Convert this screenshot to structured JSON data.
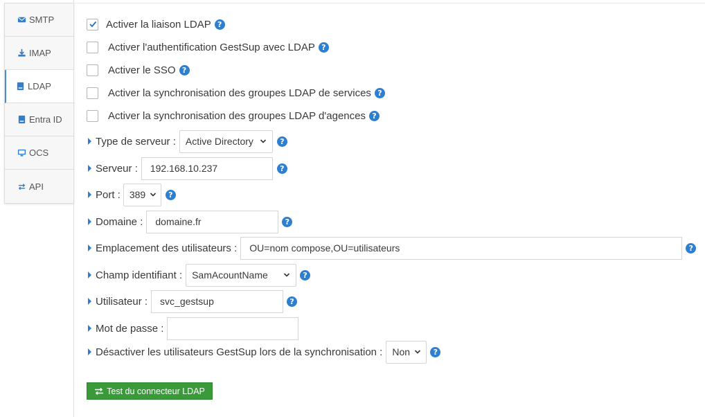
{
  "tabs": [
    {
      "label": "SMTP",
      "icon": "envelope-icon"
    },
    {
      "label": "IMAP",
      "icon": "download-icon"
    },
    {
      "label": "LDAP",
      "icon": "server-icon",
      "active": true
    },
    {
      "label": "Entra ID",
      "icon": "server-icon"
    },
    {
      "label": "OCS",
      "icon": "monitor-icon"
    },
    {
      "label": "API",
      "icon": "exchange-icon"
    }
  ],
  "checkboxes": [
    {
      "label": "Activer la liaison LDAP",
      "checked": true
    },
    {
      "label": "Activer l'authentification GestSup avec LDAP",
      "checked": false
    },
    {
      "label": "Activer le SSO",
      "checked": false
    },
    {
      "label": "Activer la synchronisation des groupes LDAP de services",
      "checked": false
    },
    {
      "label": "Activer la synchronisation des groupes LDAP d'agences",
      "checked": false
    }
  ],
  "fields": {
    "server_type": {
      "label": "Type de serveur :",
      "value": "Active Directory"
    },
    "server": {
      "label": "Serveur :",
      "value": "192.168.10.237"
    },
    "port": {
      "label": "Port :",
      "value": "389"
    },
    "domain": {
      "label": "Domaine :",
      "value": "domaine.fr"
    },
    "users_location": {
      "label": "Emplacement des utilisateurs :",
      "value": "OU=nom compose,OU=utilisateurs"
    },
    "id_field": {
      "label": "Champ identifiant :",
      "value": "SamAcountName"
    },
    "user": {
      "label": "Utilisateur :",
      "value": "svc_gestsup"
    },
    "password": {
      "label": "Mot de passe :",
      "value": ""
    },
    "disable_users": {
      "label": "Désactiver les utilisateurs GestSup lors de la synchronisation :",
      "value": "Non"
    }
  },
  "help_glyph": "?",
  "test_button": {
    "label": "Test du connecteur LDAP"
  },
  "colors": {
    "accent": "#2f7fd0",
    "button_green": "#3a9a3a"
  }
}
